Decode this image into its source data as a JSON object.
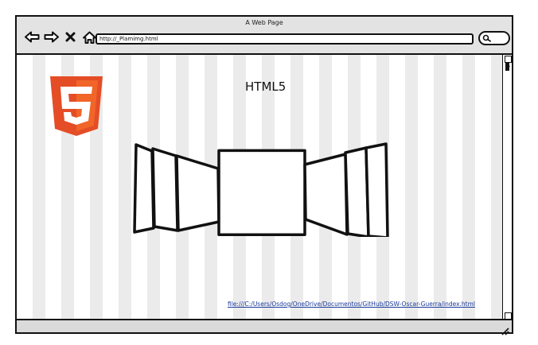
{
  "window": {
    "title": "A Web Page"
  },
  "toolbar": {
    "back_icon": "back-arrow-icon",
    "forward_icon": "forward-arrow-icon",
    "stop_icon": "close-icon",
    "home_icon": "home-icon",
    "url": "http://_Plamimg.html",
    "search_icon": "search-icon"
  },
  "page": {
    "logo": "html5-logo",
    "heading": "HTML5",
    "carousel_icon": "image-carousel",
    "footer_link": "file:///C:/Users/Osdog/OneDrive/Documentos/GitHub/DSW-Oscar-Guerra/index.html"
  },
  "colors": {
    "html5_orange": "#f16529",
    "html5_dark_orange": "#e44d26",
    "link_blue": "#1a3a9b",
    "stripe_gray": "#ebebeb"
  }
}
